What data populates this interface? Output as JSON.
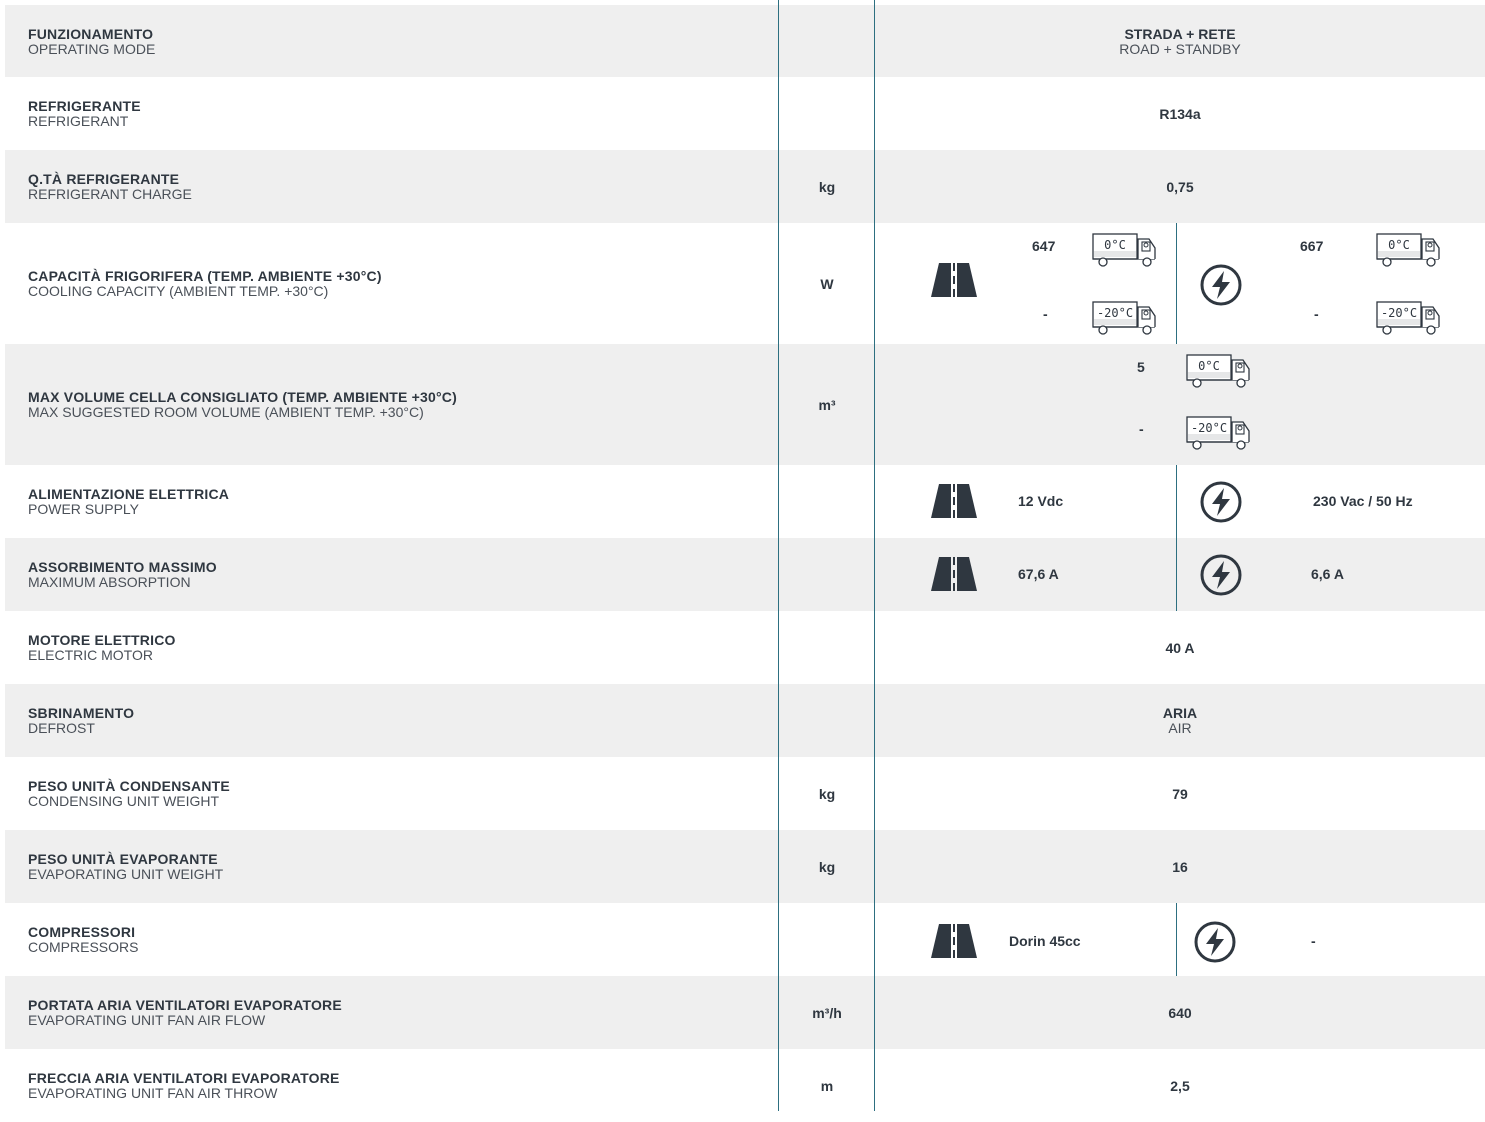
{
  "rows": [
    {
      "it": "FUNZIONAMENTO",
      "en": "OPERATING MODE",
      "unit": "",
      "val_it": "STRADA + RETE",
      "val_en": "ROAD + STANDBY"
    },
    {
      "it": "REFRIGERANTE",
      "en": "REFRIGERANT",
      "unit": "",
      "val": "R134a"
    },
    {
      "it": "Q.TÀ REFRIGERANTE",
      "en": "REFRIGERANT CHARGE",
      "unit": "kg",
      "val": "0,75"
    },
    {
      "it": "CAPACITÀ FRIGORIFERA (TEMP. AMBIENTE +30°C)",
      "en": "COOLING CAPACITY (AMBIENT TEMP. +30°C)",
      "unit": "W",
      "road_0": "647",
      "road_20": "-",
      "grid_0": "667",
      "grid_20": "-"
    },
    {
      "it": "MAX VOLUME CELLA CONSIGLIATO (TEMP. AMBIENTE +30°C)",
      "en": "MAX SUGGESTED ROOM VOLUME (AMBIENT TEMP. +30°C)",
      "unit": "m³",
      "v_0": "5",
      "v_20": "-"
    },
    {
      "it": "ALIMENTAZIONE ELETTRICA",
      "en": "POWER SUPPLY",
      "unit": "",
      "road": "12 Vdc",
      "grid": "230 Vac / 50 Hz"
    },
    {
      "it": "ASSORBIMENTO MASSIMO",
      "en": "MAXIMUM ABSORPTION",
      "unit": "",
      "road": "67,6 A",
      "grid": "6,6 A"
    },
    {
      "it": "MOTORE ELETTRICO",
      "en": "ELECTRIC MOTOR",
      "unit": "",
      "val": "40 A"
    },
    {
      "it": "SBRINAMENTO",
      "en": "DEFROST",
      "unit": "",
      "val_it": "ARIA",
      "val_en": "AIR"
    },
    {
      "it": "PESO UNITÀ CONDENSANTE",
      "en": "CONDENSING UNIT WEIGHT",
      "unit": "kg",
      "val": "79"
    },
    {
      "it": "PESO UNITÀ EVAPORANTE",
      "en": "EVAPORATING UNIT WEIGHT",
      "unit": "kg",
      "val": "16"
    },
    {
      "it": "COMPRESSORI",
      "en": "COMPRESSORS",
      "unit": "",
      "road": "Dorin 45cc",
      "grid": "-"
    },
    {
      "it": "PORTATA ARIA VENTILATORI EVAPORATORE",
      "en": "EVAPORATING UNIT FAN AIR FLOW",
      "unit": "m³/h",
      "val": "640"
    },
    {
      "it": "FRECCIA ARIA VENTILATORI EVAPORATORE",
      "en": "EVAPORATING UNIT FAN AIR THROW",
      "unit": "m",
      "val": "2,5"
    }
  ],
  "truck_labels": {
    "t0": "0°C",
    "t20": "-20°C"
  },
  "colors": {
    "accent": "#2d6f80",
    "shade": "#efefef",
    "text": "#2f3740"
  }
}
